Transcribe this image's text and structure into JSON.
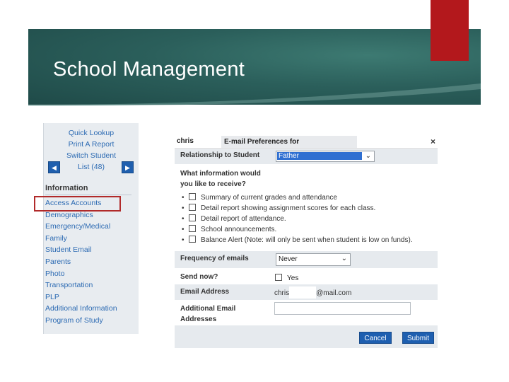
{
  "slide": {
    "title": "School Management"
  },
  "colors": {
    "banner": "#2b5f5b",
    "accent_red": "#b3181c",
    "link": "#2d6bb3",
    "button": "#1e5fb0"
  },
  "sidebar": {
    "lookup_links": [
      "Quick Lookup",
      "Print A Report",
      "Switch Student",
      "List (48)"
    ],
    "prev_icon": "left-arrow-icon",
    "next_icon": "right-arrow-icon",
    "heading": "Information",
    "links": [
      "Access Accounts",
      "Demographics",
      "Emergency/Medical",
      "Family",
      "Student Email",
      "Parents",
      "Photo",
      "Transportation",
      "PLP",
      "Additional Information",
      "Program of Study"
    ]
  },
  "dialog": {
    "title_name": "chris",
    "title_text": "E-mail Preferences for",
    "close_label": "×",
    "relationship_label": "Relationship to Student",
    "relationship_value": "Father",
    "info_question": "What information would you like to receive?",
    "options": [
      "Summary of current grades and attendance",
      "Detail report showing assignment scores for each class.",
      "Detail report of attendance.",
      "School announcements.",
      "Balance Alert (Note: will only be sent when student is low on funds)."
    ],
    "frequency_label": "Frequency of emails",
    "frequency_value": "Never",
    "send_now_label": "Send now?",
    "send_now_option": "Yes",
    "email_label": "Email Address",
    "email_value_start": "chris",
    "email_value_end": "@mail.com",
    "additional_email_label": "Additional Email Addresses",
    "cancel_label": "Cancel",
    "submit_label": "Submit"
  }
}
